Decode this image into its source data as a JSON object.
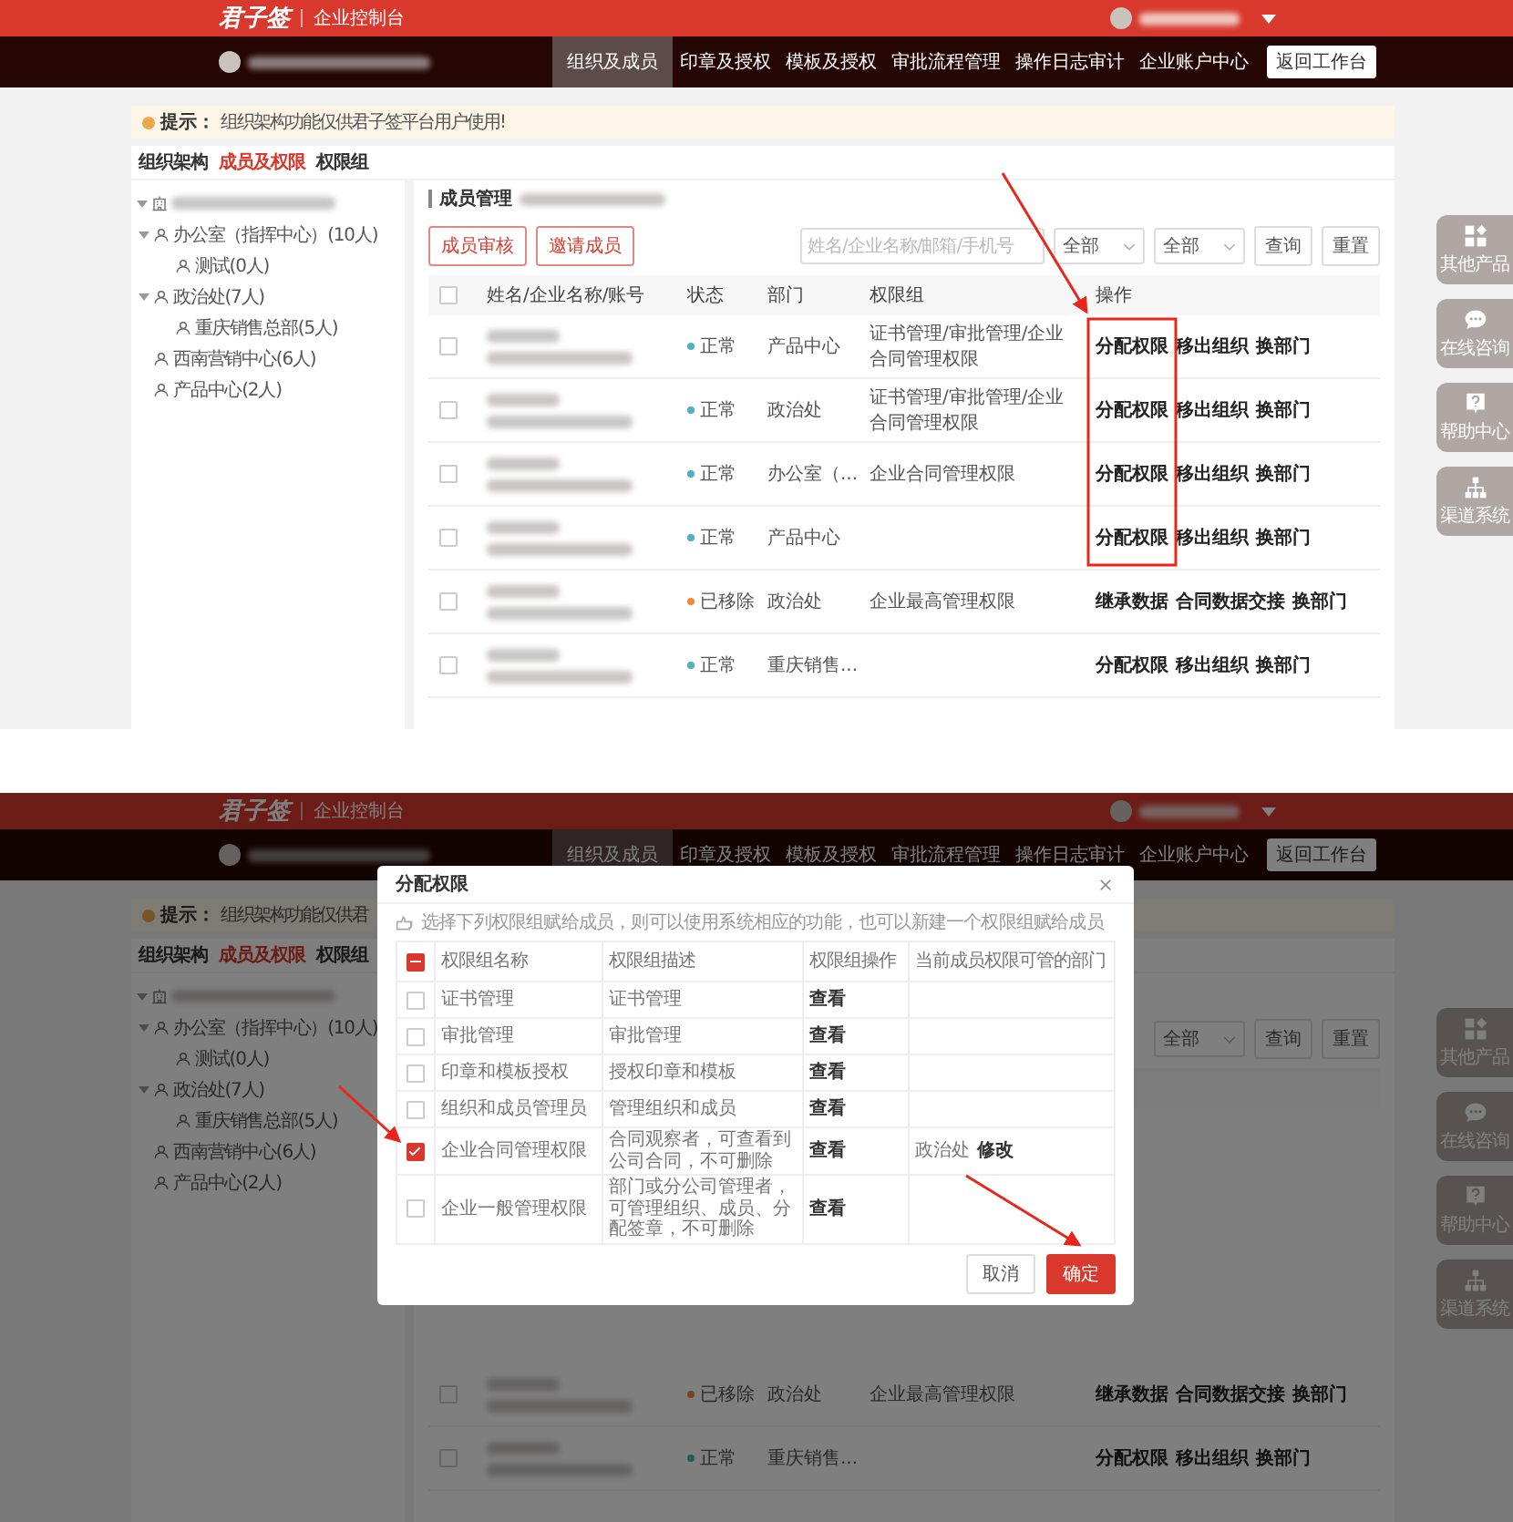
{
  "screens": [
    {
      "header": {
        "logo": "君子签",
        "subtitle": "企业控制台"
      },
      "nav": {
        "items": [
          {
            "label": "组织及成员",
            "selected": true
          },
          {
            "label": "印章及授权",
            "selected": false
          },
          {
            "label": "模板及授权",
            "selected": false
          },
          {
            "label": "审批流程管理",
            "selected": false
          },
          {
            "label": "操作日志审计",
            "selected": false
          },
          {
            "label": "企业账户中心",
            "selected": false
          }
        ],
        "return_button": "返回工作台"
      },
      "tip": {
        "label": "提示：",
        "text": "组织架构功能仅供君子签平台用户使用!"
      },
      "tabs": [
        {
          "label": "组织架构",
          "selected": false
        },
        {
          "label": "成员及权限",
          "selected": true
        },
        {
          "label": "权限组",
          "selected": false
        }
      ],
      "tree": {
        "expanded": true,
        "children": [
          {
            "label": "办公室（指挥中心）(10人)",
            "expanded": true,
            "children": [
              {
                "label": "测试(0人)"
              }
            ]
          },
          {
            "label": "政治处(7人)",
            "expanded": true,
            "children": [
              {
                "label": "重庆销售总部(5人)"
              }
            ]
          },
          {
            "label": "西南营销中心(6人)"
          },
          {
            "label": "产品中心(2人)"
          }
        ]
      },
      "panel_title": "成员管理",
      "toolbar": {
        "buttons": [
          "成员审核",
          "邀请成员"
        ],
        "search_placeholder": "姓名/企业名称/邮箱/手机号",
        "selects": [
          "全部",
          "全部"
        ],
        "query": "查询",
        "reset": "重置"
      },
      "table": {
        "header_checked": false,
        "columns": [
          "姓名/企业名称/账号",
          "状态",
          "部门",
          "权限组",
          "操作"
        ],
        "rows": [
          {
            "checked": false,
            "status": "正常",
            "color": "#4bb3bd",
            "department": "产品中心",
            "groups": "证书管理/审批管理/企业合同管理权限",
            "actions": [
              "分配权限",
              "移出组织",
              "换部门"
            ]
          },
          {
            "checked": false,
            "status": "正常",
            "color": "#4bb3bd",
            "department": "政治处",
            "groups": "证书管理/审批管理/企业合同管理权限",
            "actions": [
              "分配权限",
              "移出组织",
              "换部门"
            ]
          },
          {
            "checked": false,
            "status": "正常",
            "color": "#4bb3bd",
            "department": "办公室（...",
            "groups": "企业合同管理权限",
            "actions": [
              "分配权限",
              "移出组织",
              "换部门"
            ]
          },
          {
            "checked": false,
            "status": "正常",
            "color": "#4bb3bd",
            "department": "产品中心",
            "actions": [
              "分配权限",
              "移出组织",
              "换部门"
            ]
          },
          {
            "checked": false,
            "status": "已移除",
            "color": "#f0883a",
            "department": "政治处",
            "groups": "企业最高管理权限",
            "actions": [
              "继承数据",
              "合同数据交接",
              "换部门"
            ]
          },
          {
            "checked": false,
            "status": "正常",
            "color": "#4bb3bd",
            "department": "重庆销售...",
            "actions": [
              "分配权限",
              "移出组织",
              "换部门"
            ]
          }
        ]
      },
      "side_buttons": [
        "其他产品",
        "在线咨询",
        "帮助中心",
        "渠道系统"
      ]
    },
    {
      "header": {
        "logo": "君子签",
        "subtitle": "企业控制台"
      },
      "nav": {
        "items": [
          {
            "label": "组织及成员",
            "selected": true
          },
          {
            "label": "印章及授权",
            "selected": false
          },
          {
            "label": "模板及授权",
            "selected": false
          },
          {
            "label": "审批流程管理",
            "selected": false
          },
          {
            "label": "操作日志审计",
            "selected": false
          },
          {
            "label": "企业账户中心",
            "selected": false
          }
        ],
        "return_button": "返回工作台"
      },
      "tip": {
        "label": "提示：",
        "text": "组织架构功能仅供君"
      },
      "tabs": [
        {
          "label": "组织架构",
          "selected": false
        },
        {
          "label": "成员及权限",
          "selected": true
        },
        {
          "label": "权限组",
          "selected": false
        }
      ],
      "tree": {
        "expanded": true,
        "children": [
          {
            "label": "办公室（指挥中心）(10人)",
            "expanded": true,
            "children": [
              {
                "label": "测试(0人)"
              }
            ]
          },
          {
            "label": "政治处(7人)",
            "expanded": true,
            "children": [
              {
                "label": "重庆销售总部(5人)"
              }
            ]
          },
          {
            "label": "西南营销中心(6人)"
          },
          {
            "label": "产品中心(2人)"
          }
        ]
      },
      "toolbar": {
        "selects": [
          "全部"
        ],
        "query": "查询",
        "reset": "重置"
      },
      "table": {
        "rows": [
          {
            "checked": false,
            "status": "已移除",
            "color": "#78441d",
            "department": "政治处",
            "groups": "企业最高管理权限",
            "actions": [
              "继承数据",
              "合同数据交接",
              "换部门"
            ]
          },
          {
            "checked": false,
            "status": "正常",
            "color": "#255a5e",
            "department": "重庆销售...",
            "actions": [
              "分配权限",
              "移出组织",
              "换部门"
            ]
          }
        ]
      },
      "side_buttons": [
        "其他产品",
        "在线咨询",
        "帮助中心",
        "渠道系统"
      ],
      "modal": {
        "title": "分配权限",
        "hint": "选择下列权限组赋给成员，则可以使用系统相应的功能，也可以新建一个权限组赋给成员",
        "header_indeterminate": true,
        "columns": [
          "权限组名称",
          "权限组描述",
          "权限组操作",
          "当前成员权限可管的部门"
        ],
        "rows": [
          {
            "checked": false,
            "name": "证书管理",
            "description": "证书管理",
            "action": "查看"
          },
          {
            "checked": false,
            "name": "审批管理",
            "description": "审批管理",
            "action": "查看"
          },
          {
            "checked": false,
            "name": "印章和模板授权",
            "description": "授权印章和模板",
            "action": "查看"
          },
          {
            "checked": false,
            "name": "组织和成员管理员",
            "description": "管理组织和成员",
            "action": "查看"
          },
          {
            "checked": true,
            "name": "企业合同管理权限",
            "description": "合同观察者，可查看到公司合同，不可删除",
            "action": "查看",
            "department": "政治处",
            "edit": "修改"
          },
          {
            "checked": false,
            "name": "企业一般管理权限",
            "description": "部门或分公司管理者，可管理组织、成员、分配签章，不可删除",
            "action": "查看"
          }
        ],
        "buttons": {
          "cancel": "取消",
          "confirm": "确定"
        }
      }
    }
  ]
}
